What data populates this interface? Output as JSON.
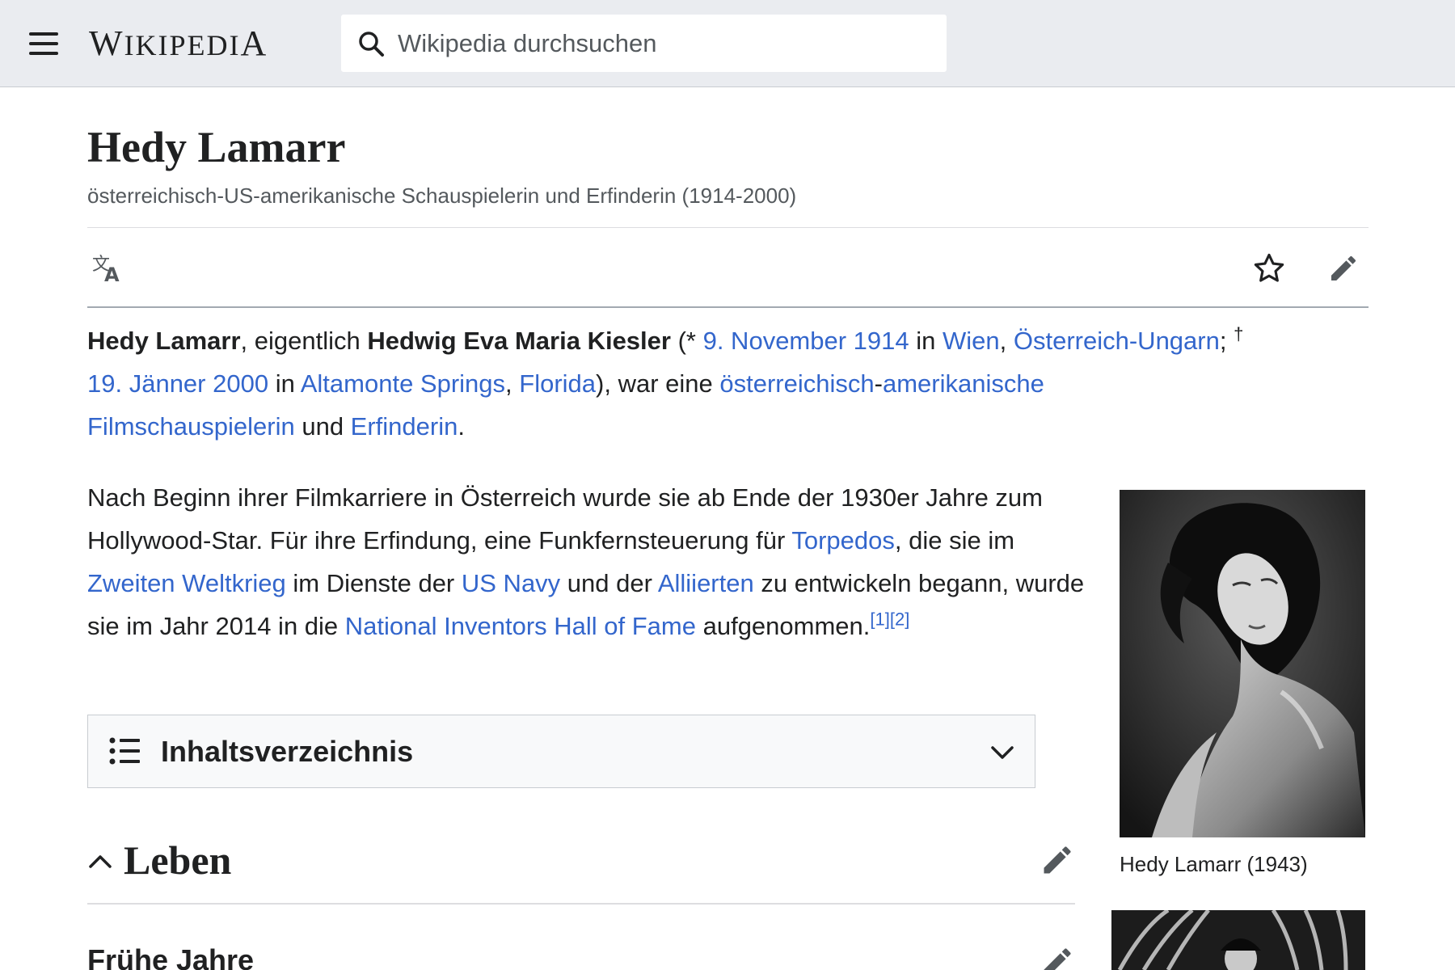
{
  "header": {
    "wordmark_first": "W",
    "wordmark_rest": "IKIPEDI",
    "wordmark_last": "A",
    "search_placeholder": "Wikipedia durchsuchen"
  },
  "article": {
    "title": "Hedy Lamarr",
    "tagline": "österreichisch-US-amerikanische Schauspielerin und Erfinderin (1914-2000)"
  },
  "lead": {
    "name": "Hedy Lamarr",
    "t1": ", eigentlich ",
    "birth_name": "Hedwig Eva Maria Kiesler",
    "t2": " (* ",
    "birth_date": "9. November 1914",
    "t3": " in ",
    "birth_place": "Wien",
    "t4": ", ",
    "birth_country": "Österreich-Ungarn",
    "t5": "; ",
    "dagger": "†",
    "death_date": "19. Jänner 2000",
    "t6": " in ",
    "death_place": "Altamonte Springs",
    "t7": ", ",
    "death_state": "Florida",
    "t8": "), war eine ",
    "nationality": "österreichisch",
    "t9": "-",
    "nationality2": "amerikanische",
    "profession1": "Filmschauspielerin",
    "t10": " und ",
    "profession2": "Erfinderin",
    "t11": "."
  },
  "paragraph2": {
    "s1": "Nach Beginn ihrer Filmkarriere in Österreich wurde sie ab Ende der 1930er Jahre zum Hollywood-Star. Für ihre Erfindung, eine Funkfernsteuerung für ",
    "link_torpedos": "Torpedos",
    "s2": ", die sie im ",
    "link_ww2": "Zweiten Weltkrieg",
    "s3": " im Dienste der ",
    "link_navy": "US Navy",
    "s4": " und der ",
    "link_allies": "Alliierten",
    "s5": " zu entwickeln begann, wurde sie im Jahr 2014 in die ",
    "link_nihf": "National Inventors Hall of Fame",
    "s6": " aufgenommen.",
    "ref1": "[1]",
    "ref2": "[2]"
  },
  "toc": {
    "title": "Inhaltsverzeichnis"
  },
  "sections": {
    "leben": "Leben",
    "fruehe_jahre": "Frühe Jahre"
  },
  "figure": {
    "caption": "Hedy Lamarr (1943)"
  },
  "colors": {
    "link": "#3366cc",
    "text": "#202122",
    "header_bg": "#eaecf0",
    "muted": "#54595d"
  }
}
